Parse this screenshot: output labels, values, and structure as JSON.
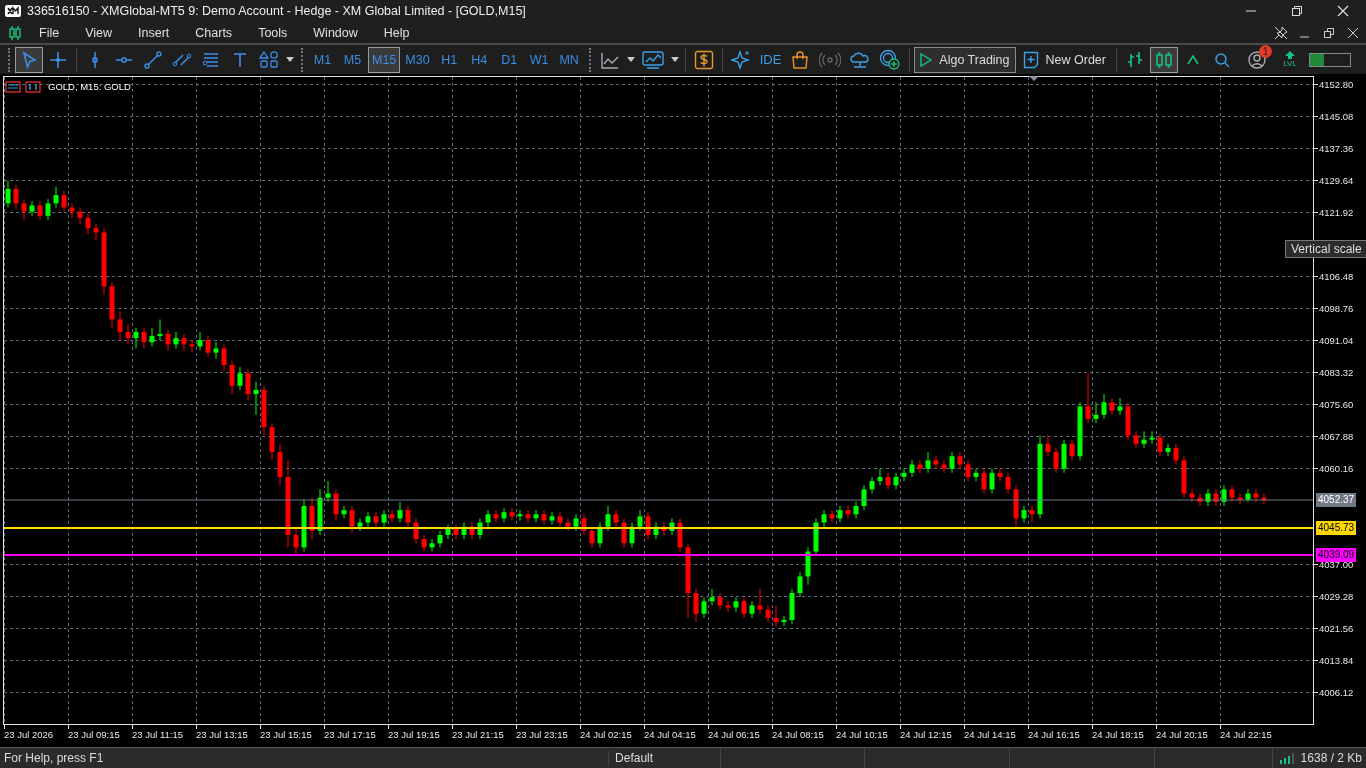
{
  "window": {
    "title": "336516150 - XMGlobal-MT5 9: Demo Account - Hedge - XM Global Limited - [GOLD,M15]"
  },
  "menu": [
    "File",
    "View",
    "Insert",
    "Charts",
    "Tools",
    "Window",
    "Help"
  ],
  "drawing_tools": [
    {
      "selected": true
    },
    {
      "selected": false
    },
    {
      "selected": false
    },
    {
      "selected": false
    },
    {
      "selected": false
    },
    {
      "selected": false
    },
    {
      "selected": false
    },
    {
      "selected": false
    },
    {
      "selected": false
    }
  ],
  "timeframes": [
    {
      "label": "M1",
      "selected": false
    },
    {
      "label": "M5",
      "selected": false
    },
    {
      "label": "M15",
      "selected": true
    },
    {
      "label": "M30",
      "selected": false
    },
    {
      "label": "H1",
      "selected": false
    },
    {
      "label": "H4",
      "selected": false
    },
    {
      "label": "D1",
      "selected": false
    },
    {
      "label": "W1",
      "selected": false
    },
    {
      "label": "MN",
      "selected": false
    }
  ],
  "ide_label": "IDE",
  "algo_trading": {
    "label": "Algo Trading",
    "on": true
  },
  "new_order": {
    "label": "New Order"
  },
  "chart_types": [
    {
      "selected": false
    },
    {
      "selected": true
    },
    {
      "selected": false
    }
  ],
  "notifications": {
    "count": "1"
  },
  "lvl_label": "LVL",
  "memory_meter": {
    "level": 0.35
  },
  "chart": {
    "caption": "GOLD, M15:  GOLD",
    "time_labels": [
      "23 Jul 2026",
      "23 Jul 09:15",
      "23 Jul 11:15",
      "23 Jul 13:15",
      "23 Jul 15:15",
      "23 Jul 17:15",
      "23 Jul 19:15",
      "23 Jul 21:15",
      "23 Jul 23:15",
      "24 Jul 02:15",
      "24 Jul 04:15",
      "24 Jul 06:15",
      "24 Jul 08:15",
      "24 Jul 10:15",
      "24 Jul 12:15",
      "24 Jul 14:15",
      "24 Jul 16:15",
      "24 Jul 18:15",
      "24 Jul 20:15",
      "24 Jul 22:15"
    ],
    "chart_data": {
      "type": "candlestick",
      "ylim": [
        3998.4,
        4154.73
      ],
      "grid": true,
      "ref_lines": [
        {
          "axis": "y",
          "value": 4052.37,
          "label": "4052.37",
          "color": "#6f7a86"
        },
        {
          "axis": "y",
          "value": 4045.73,
          "label": "4045.73",
          "color": "#ffd700"
        },
        {
          "axis": "y",
          "value": 4039.09,
          "label": "4039.09",
          "color": "#ff00ff"
        }
      ],
      "yticks": [
        {
          "value": 4152.8,
          "label": "4152.80"
        },
        {
          "value": 4145.08,
          "label": "4145.08"
        },
        {
          "value": 4137.36,
          "label": "4137.36"
        },
        {
          "value": 4129.64,
          "label": "4129.64"
        },
        {
          "value": 4121.92,
          "label": "4121.92"
        },
        {
          "value": 4106.48,
          "label": "4106.48"
        },
        {
          "value": 4098.76,
          "label": "4098.76"
        },
        {
          "value": 4091.04,
          "label": "4091.04"
        },
        {
          "value": 4083.32,
          "label": "4083.32"
        },
        {
          "value": 4075.6,
          "label": "4075.60"
        },
        {
          "value": 4067.88,
          "label": "4067.88"
        },
        {
          "value": 4060.16,
          "label": "4060.16"
        },
        {
          "value": 4037,
          "label": "4037.00"
        },
        {
          "value": 4029.28,
          "label": "4029.28"
        },
        {
          "value": 4021.56,
          "label": "4021.56"
        },
        {
          "value": 4013.84,
          "label": "4013.84"
        },
        {
          "value": 4006.12,
          "label": "4006.12"
        }
      ],
      "ohlc": [
        [
          4124,
          4129.5,
          4123,
          4127.5
        ],
        [
          4127.5,
          4128.5,
          4122.5,
          4124
        ],
        [
          4124,
          4125,
          4120,
          4122
        ],
        [
          4122,
          4124.5,
          4121,
          4123.5
        ],
        [
          4123.5,
          4124.5,
          4120,
          4121
        ],
        [
          4121,
          4125,
          4120,
          4124
        ],
        [
          4124,
          4128,
          4123,
          4126
        ],
        [
          4126,
          4127,
          4122,
          4123
        ],
        [
          4123,
          4124,
          4120.5,
          4122
        ],
        [
          4122,
          4123,
          4119,
          4120.5
        ],
        [
          4120.5,
          4121.5,
          4116.5,
          4118
        ],
        [
          4118,
          4119,
          4115,
          4117
        ],
        [
          4117,
          4118,
          4102,
          4104
        ],
        [
          4104,
          4105,
          4094,
          4096
        ],
        [
          4096,
          4098,
          4091,
          4093
        ],
        [
          4093,
          4095,
          4090,
          4091.5
        ],
        [
          4091.5,
          4094,
          4089,
          4093
        ],
        [
          4093,
          4094,
          4089,
          4090.5
        ],
        [
          4090.5,
          4094,
          4089.5,
          4092
        ],
        [
          4092,
          4096,
          4091,
          4092.5
        ],
        [
          4092.5,
          4093.5,
          4088.5,
          4090
        ],
        [
          4090,
          4093,
          4089,
          4091.5
        ],
        [
          4091.5,
          4092.5,
          4088.5,
          4090
        ],
        [
          4090,
          4091,
          4088,
          4089.5
        ],
        [
          4089.5,
          4093,
          4088.5,
          4091
        ],
        [
          4091,
          4092,
          4087,
          4088
        ],
        [
          4088,
          4090.5,
          4086.5,
          4089
        ],
        [
          4089,
          4090,
          4083.5,
          4085
        ],
        [
          4085,
          4086,
          4078,
          4080
        ],
        [
          4080,
          4084.5,
          4079,
          4083
        ],
        [
          4083,
          4084,
          4076.5,
          4078
        ],
        [
          4078,
          4081,
          4073,
          4079
        ],
        [
          4079,
          4080,
          4068,
          4070
        ],
        [
          4070,
          4071,
          4062,
          4064
        ],
        [
          4064,
          4066,
          4056,
          4058
        ],
        [
          4058,
          4062,
          4041,
          4044
        ],
        [
          4044,
          4046,
          4039,
          4041
        ],
        [
          4041,
          4052.5,
          4040,
          4051
        ],
        [
          4051,
          4053,
          4043,
          4045
        ],
        [
          4045,
          4055,
          4044,
          4053
        ],
        [
          4053,
          4057,
          4052,
          4054
        ],
        [
          4054,
          4055,
          4047.5,
          4049
        ],
        [
          4049,
          4051,
          4048,
          4050
        ],
        [
          4050,
          4051,
          4044.5,
          4046
        ],
        [
          4046,
          4048,
          4045,
          4047
        ],
        [
          4047,
          4049.5,
          4046,
          4048.5
        ],
        [
          4048.5,
          4049.5,
          4046,
          4047
        ],
        [
          4047,
          4050,
          4046,
          4049
        ],
        [
          4049,
          4050,
          4047,
          4048
        ],
        [
          4048,
          4052,
          4047,
          4050
        ],
        [
          4050,
          4051,
          4046,
          4047
        ],
        [
          4047,
          4048,
          4042,
          4043
        ],
        [
          4043,
          4044,
          4040,
          4041
        ],
        [
          4041,
          4043,
          4040,
          4042
        ],
        [
          4042,
          4045,
          4041,
          4044
        ],
        [
          4044,
          4046.5,
          4043,
          4045.5
        ],
        [
          4045.5,
          4046.5,
          4043,
          4044
        ],
        [
          4044,
          4047,
          4043,
          4046
        ],
        [
          4046,
          4047,
          4043,
          4044
        ],
        [
          4044,
          4048,
          4043,
          4047
        ],
        [
          4047,
          4050,
          4046,
          4049
        ],
        [
          4049,
          4050,
          4047,
          4048
        ],
        [
          4048,
          4050.5,
          4047,
          4049.5
        ],
        [
          4049.5,
          4050.5,
          4047.5,
          4048.5
        ],
        [
          4048.5,
          4050,
          4047.5,
          4049
        ],
        [
          4049,
          4050,
          4047,
          4048
        ],
        [
          4048,
          4050,
          4047,
          4049
        ],
        [
          4049,
          4050,
          4046.5,
          4047.5
        ],
        [
          4047.5,
          4049.5,
          4046.5,
          4048.5
        ],
        [
          4048.5,
          4049.5,
          4046,
          4047
        ],
        [
          4047,
          4048,
          4045,
          4046
        ],
        [
          4046,
          4049,
          4045,
          4048
        ],
        [
          4048,
          4049,
          4044,
          4045
        ],
        [
          4045,
          4046,
          4041,
          4042
        ],
        [
          4042,
          4047,
          4041,
          4046
        ],
        [
          4046,
          4051,
          4045,
          4049
        ],
        [
          4049,
          4050,
          4046,
          4047
        ],
        [
          4047,
          4048,
          4041,
          4042
        ],
        [
          4042,
          4047,
          4041,
          4046
        ],
        [
          4046,
          4050,
          4045,
          4048.5
        ],
        [
          4048.5,
          4049.5,
          4043,
          4044
        ],
        [
          4044,
          4047,
          4043,
          4046
        ],
        [
          4046,
          4047,
          4044,
          4045
        ],
        [
          4045,
          4048,
          4044,
          4047
        ],
        [
          4047,
          4048,
          4040,
          4041
        ],
        [
          4041,
          4042,
          4024,
          4030
        ],
        [
          4030,
          4031,
          4023,
          4025
        ],
        [
          4025,
          4029,
          4024,
          4028
        ],
        [
          4028,
          4031,
          4027,
          4029
        ],
        [
          4029,
          4030,
          4026,
          4027
        ],
        [
          4027,
          4028,
          4025.5,
          4026.5
        ],
        [
          4026.5,
          4029,
          4025.5,
          4028
        ],
        [
          4028,
          4029,
          4024,
          4025
        ],
        [
          4025,
          4028,
          4024,
          4027
        ],
        [
          4027,
          4031,
          4025,
          4026
        ],
        [
          4026,
          4027,
          4023,
          4024
        ],
        [
          4024,
          4027,
          4022,
          4023
        ],
        [
          4023,
          4024.5,
          4022,
          4023.5
        ],
        [
          4023.5,
          4031,
          4022.5,
          4030
        ],
        [
          4030,
          4035,
          4029,
          4034
        ],
        [
          4034,
          4041,
          4032,
          4040
        ],
        [
          4040,
          4048,
          4039,
          4047
        ],
        [
          4047,
          4050,
          4046,
          4049
        ],
        [
          4049,
          4050,
          4047,
          4048
        ],
        [
          4048,
          4051,
          4047,
          4050
        ],
        [
          4050,
          4051,
          4048,
          4049
        ],
        [
          4049,
          4052,
          4048,
          4051
        ],
        [
          4051,
          4056,
          4050,
          4055
        ],
        [
          4055,
          4058,
          4054,
          4057
        ],
        [
          4057,
          4060,
          4056,
          4058
        ],
        [
          4058,
          4059,
          4055,
          4056
        ],
        [
          4056,
          4059,
          4055,
          4058
        ],
        [
          4058,
          4060,
          4057,
          4059
        ],
        [
          4059,
          4062,
          4058,
          4061
        ],
        [
          4061,
          4062,
          4059,
          4060
        ],
        [
          4060,
          4064,
          4059,
          4062
        ],
        [
          4062,
          4063,
          4060,
          4061
        ],
        [
          4061,
          4062,
          4059,
          4060
        ],
        [
          4060,
          4064,
          4059,
          4063
        ],
        [
          4063,
          4064,
          4060,
          4061
        ],
        [
          4061,
          4062,
          4057,
          4058
        ],
        [
          4058,
          4060,
          4057,
          4059
        ],
        [
          4059,
          4060,
          4054,
          4055
        ],
        [
          4055,
          4060,
          4054,
          4059
        ],
        [
          4059,
          4060,
          4057,
          4058
        ],
        [
          4058,
          4059,
          4054,
          4055
        ],
        [
          4055,
          4056,
          4046,
          4048
        ],
        [
          4048,
          4051,
          4047,
          4050
        ],
        [
          4050,
          4051,
          4047,
          4049
        ],
        [
          4049,
          4068,
          4048,
          4066
        ],
        [
          4066,
          4068,
          4063,
          4064
        ],
        [
          4064,
          4065,
          4059,
          4060
        ],
        [
          4060,
          4067,
          4059,
          4066
        ],
        [
          4066,
          4067,
          4062,
          4063
        ],
        [
          4063,
          4076,
          4062,
          4075
        ],
        [
          4075,
          4083,
          4071,
          4072
        ],
        [
          4072,
          4076,
          4071,
          4073
        ],
        [
          4073,
          4078,
          4072,
          4076
        ],
        [
          4076,
          4077,
          4073,
          4074
        ],
        [
          4074,
          4077,
          4073,
          4075
        ],
        [
          4075,
          4076,
          4067,
          4068
        ],
        [
          4068,
          4069,
          4065,
          4066
        ],
        [
          4066,
          4069,
          4065,
          4067
        ],
        [
          4067,
          4069,
          4066,
          4067.5
        ],
        [
          4067.5,
          4068.5,
          4063,
          4064
        ],
        [
          4064,
          4066,
          4063,
          4065
        ],
        [
          4065,
          4066,
          4061,
          4062
        ],
        [
          4062,
          4063,
          4053,
          4054
        ],
        [
          4054,
          4055,
          4052,
          4053
        ],
        [
          4053,
          4054,
          4051,
          4052
        ],
        [
          4052,
          4055,
          4051,
          4054
        ],
        [
          4054,
          4055,
          4051,
          4052
        ],
        [
          4052,
          4056,
          4051,
          4055
        ],
        [
          4055,
          4056,
          4052,
          4053
        ],
        [
          4053,
          4054,
          4051.5,
          4052.5
        ],
        [
          4052.5,
          4055,
          4052,
          4054
        ],
        [
          4054,
          4055,
          4052,
          4053
        ],
        [
          4053,
          4054,
          4051.5,
          4052.37
        ]
      ]
    },
    "tooltip": "Vertical scale"
  },
  "status_bar": {
    "help": "For Help, press F1",
    "profile": "Default",
    "traffic": "1638 / 2 Kb"
  }
}
